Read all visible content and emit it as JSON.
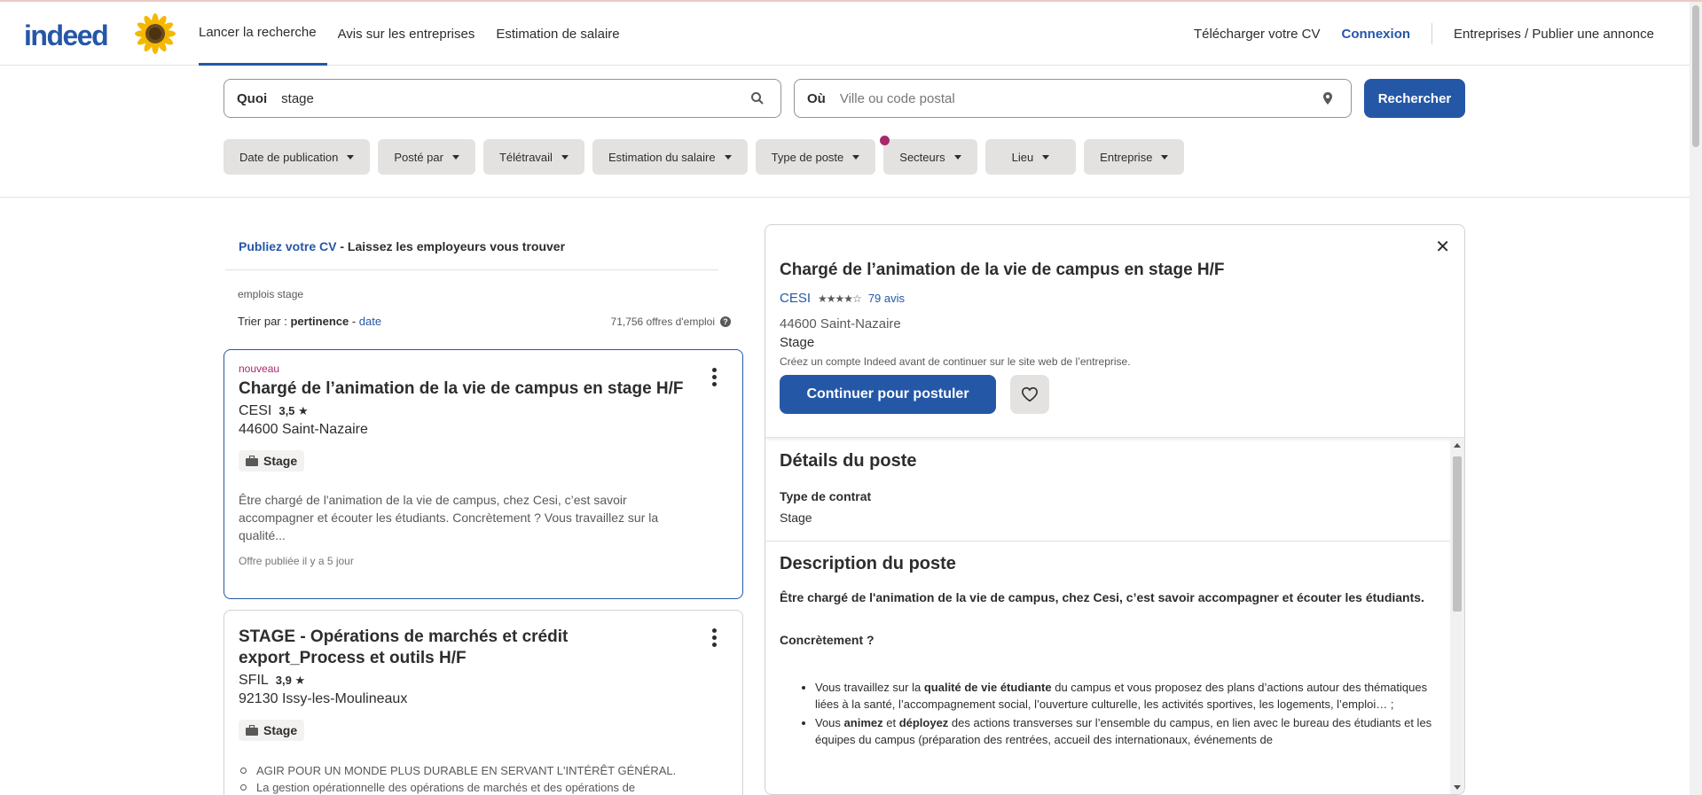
{
  "header": {
    "logo": "indeed",
    "nav": [
      "Lancer la recherche",
      "Avis sur les entreprises",
      "Estimation de salaire"
    ],
    "upload_cv": "Télécharger votre CV",
    "login": "Connexion",
    "employers": "Entreprises / Publier une annonce"
  },
  "search": {
    "what_label": "Quoi",
    "what_value": "stage",
    "where_label": "Où",
    "where_placeholder": "Ville ou code postal",
    "button": "Rechercher"
  },
  "filters": [
    "Date de publication",
    "Posté par",
    "Télétravail",
    "Estimation du salaire",
    "Type de poste",
    "Secteurs",
    "Lieu",
    "Entreprise"
  ],
  "left": {
    "publish_link": "Publiez votre CV",
    "publish_rest": " - Laissez les employeurs vous trouver",
    "emplois": "emplois stage",
    "sort_label": "Trier par : ",
    "sort_active": "pertinence",
    "sort_sep": " - ",
    "sort_other": "date",
    "count": "71,756 offres d'emploi"
  },
  "cards": [
    {
      "new": "nouveau",
      "title": "Chargé de l’animation de la vie de campus en stage H/F",
      "company": "CESI",
      "rating": "3,5 ★",
      "location": "44600 Saint-Nazaire",
      "badge": "Stage",
      "snippet": "Être chargé de l'animation de la vie de campus, chez Cesi, c’est savoir accompagner et écouter les étudiants. Concrètement ? Vous travaillez sur la qualité...",
      "posted": "Offre publiée il y a 5 jour"
    },
    {
      "title": "STAGE - Opérations de marchés et crédit export_Process et outils H/F",
      "company": "SFIL",
      "rating": "3,9 ★",
      "location": "92130 Issy-les-Moulineaux",
      "badge": "Stage",
      "bullet1": "AGIR POUR UN MONDE PLUS DURABLE EN SERVANT L'INTÉRÊT GÉNÉRAL.",
      "bullet2": "La gestion opérationnelle des opérations de marchés et des opérations de"
    }
  ],
  "detail": {
    "title": "Chargé de l’animation de la vie de campus en stage H/F",
    "company": "CESI",
    "stars": "★★★★☆",
    "reviews": "79 avis",
    "location": "44600 Saint-Nazaire",
    "type": "Stage",
    "note": "Créez un compte Indeed avant de continuer sur le site web de l’entreprise.",
    "apply": "Continuer pour postuler",
    "details_heading": "Détails du poste",
    "contract_label": "Type de contrat",
    "contract_value": "Stage",
    "desc_heading": "Description du poste",
    "desc_intro": "Être chargé de l'animation de la vie de campus, chez Cesi, c’est savoir accompagner et écouter les étudiants.",
    "concretement": "Concrètement ?",
    "li1_a": "Vous travaillez sur la ",
    "li1_b": "qualité de vie étudiante",
    "li1_c": " du campus et vous proposez des plans d’actions autour des thématiques liées à la santé, l’accompagnement social, l’ouverture culturelle, les activités sportives, les logements, l’emploi… ;",
    "li2_a": "Vous ",
    "li2_b": "animez",
    "li2_c": " et ",
    "li2_d": "déployez",
    "li2_e": " des actions transverses sur l’ensemble du campus, en lien avec le bureau des étudiants et les équipes du campus (préparation des rentrées, accueil des internationaux, événements de"
  }
}
